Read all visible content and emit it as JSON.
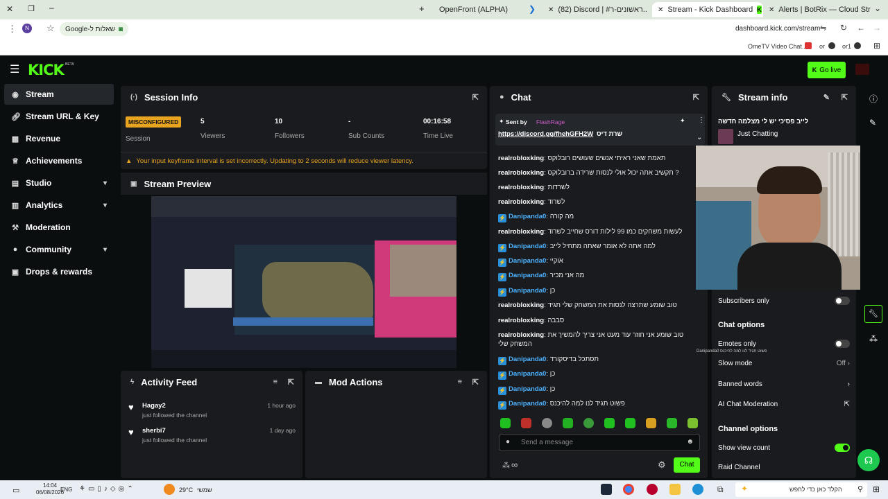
{
  "browser": {
    "tabs": [
      {
        "label": "OpenFront (ALPHA)"
      },
      {
        "label": "(82) Discord | #ראשונים-ר..."
      },
      {
        "label": "Stream - Kick Dashboard"
      },
      {
        "label": "Alerts | BotRix — Cloud Stream"
      }
    ],
    "url": "dashboard.kick.com/stream",
    "google_chip": "Google-שאלות ל",
    "bookmarks": [
      "OmeTV Video Chat...",
      "or",
      "or1"
    ],
    "profile_initial": "N"
  },
  "header": {
    "logo": "KICK",
    "logo_badge": "BETA",
    "go_live": "Go live"
  },
  "sidebar": {
    "items": [
      {
        "label": "Stream",
        "icon": "broadcast-icon"
      },
      {
        "label": "Stream URL & Key",
        "icon": "link-icon"
      },
      {
        "label": "Revenue",
        "icon": "revenue-icon"
      },
      {
        "label": "Achievements",
        "icon": "trophy-icon"
      },
      {
        "label": "Studio",
        "icon": "studio-icon"
      },
      {
        "label": "Analytics",
        "icon": "analytics-icon"
      },
      {
        "label": "Moderation",
        "icon": "gavel-icon"
      },
      {
        "label": "Community",
        "icon": "community-icon"
      },
      {
        "label": "Drops & rewards",
        "icon": "gift-icon"
      }
    ]
  },
  "session": {
    "title": "Session Info",
    "status_badge": "MISCONFIGURED",
    "status_label": "Session",
    "stats": [
      {
        "value": "5",
        "label": "Viewers"
      },
      {
        "value": "10",
        "label": "Followers"
      },
      {
        "value": "-",
        "label": "Sub Counts"
      },
      {
        "value": "00:16:58",
        "label": "Time Live"
      }
    ],
    "warning": "Your input keyframe interval is set incorrectly. Updating to 2 seconds will reduce viewer latency."
  },
  "preview": {
    "title": "Stream Preview"
  },
  "activity": {
    "title": "Activity Feed",
    "items": [
      {
        "user": "Hagay2",
        "action": "just followed the channel",
        "time": "1 hour ago"
      },
      {
        "user": "sherbi7",
        "action": "just followed the channel",
        "time": "1 day ago"
      }
    ]
  },
  "mod_actions": {
    "title": "Mod Actions"
  },
  "chat": {
    "title": "Chat",
    "pinned_by_label": "Sent by",
    "pinned_by_user": "FlashRage",
    "pinned_link": "https://discord.gg/fhehGFH2W",
    "pinned_text": "שרת דיס",
    "messages": [
      {
        "user": "realrobloxking",
        "badge": false,
        "text": "תאמת שאני ראיתי אנשים שעושים רובלוקס"
      },
      {
        "user": "realrobloxking",
        "badge": false,
        "text": "תקשיב אתה יכול אולי לנסות שרידה ברובלוקס ?"
      },
      {
        "user": "realrobloxking",
        "badge": false,
        "text": "לשרדות"
      },
      {
        "user": "realrobloxking",
        "badge": false,
        "text": "לשרוד"
      },
      {
        "user": "Danipanda0",
        "badge": true,
        "text": "מה קורה"
      },
      {
        "user": "realrobloxking",
        "badge": false,
        "text": "לעשות משחקים כמו 99 לילות דורס שחייב לשרוד"
      },
      {
        "user": "Danipanda0",
        "badge": true,
        "text": "למה אתה לא אומר שאתה מתחיל לייב"
      },
      {
        "user": "Danipanda0",
        "badge": true,
        "text": "אוקיי"
      },
      {
        "user": "Danipanda0",
        "badge": true,
        "text": "מה אני מכיר"
      },
      {
        "user": "Danipanda0",
        "badge": true,
        "text": "כן"
      },
      {
        "user": "realrobloxking",
        "badge": false,
        "text": "טוב שומע שתרצה לנסות את המשחק שלי תגיד"
      },
      {
        "user": "realrobloxking",
        "badge": false,
        "text": "סבבה"
      },
      {
        "user": "realrobloxking",
        "badge": false,
        "text": "טוב שומע אני חוזר עוד מעט אני צריך להמשיך את המשחק שלי"
      },
      {
        "user": "Danipanda0",
        "badge": true,
        "text": "תסתכל בדיסקורד"
      },
      {
        "user": "Danipanda0",
        "badge": true,
        "text": "כן"
      },
      {
        "user": "Danipanda0",
        "badge": true,
        "text": "כן"
      },
      {
        "user": "Danipanda0",
        "badge": true,
        "text": "פשוט תגיד לנו למה להיכנס"
      }
    ],
    "input_placeholder": "Send a message",
    "send_label": "Chat",
    "infinity": "∞"
  },
  "stream_info": {
    "title": "Stream info",
    "stream_title": "לייב פסיכי יש לי מצלמה חדשה",
    "category": "Just Chatting",
    "subscribers_only": "Subscribers only",
    "chat_options": "Chat options",
    "emotes_only": "Emotes only",
    "slow_mode": "Slow mode",
    "slow_mode_value": "Off",
    "banned_words": "Banned words",
    "ai_moderation": "AI Chat Moderation",
    "channel_options": "Channel options",
    "show_view_count": "Show view count",
    "raid_channel": "Raid Channel",
    "toggles": {
      "subscribers_only": false,
      "emotes_only": false,
      "show_view_count": true
    }
  },
  "overlay": {
    "mini_text": "Danipanda0 פשוט תגיד לנו למה להיכנס"
  },
  "taskbar": {
    "time": "14:04",
    "date": "06/08/2026",
    "lang": "ENG",
    "temp": "29°C",
    "weather": "שמשי",
    "search": "הקלד כאן כדי לחפש"
  },
  "colors": {
    "accent": "#53fc18",
    "bg": "#0b0e0f",
    "panel": "#191b1f",
    "warning": "#e8a31f"
  }
}
